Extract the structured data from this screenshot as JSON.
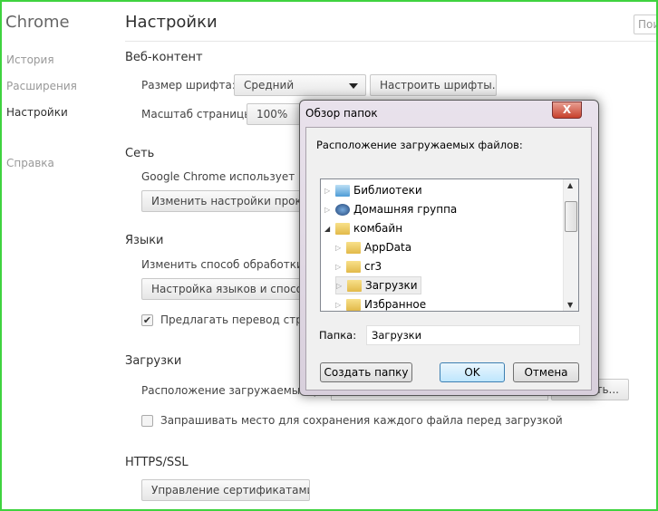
{
  "sidebar": {
    "brand": "Chrome",
    "items": [
      {
        "label": "История"
      },
      {
        "label": "Расширения"
      },
      {
        "label": "Настройки"
      },
      {
        "label": "Справка"
      }
    ]
  },
  "header": {
    "title": "Настройки",
    "search_placeholder": "Пои"
  },
  "web": {
    "title": "Веб-контент",
    "font_size_label": "Размер шрифта:",
    "font_size_value": "Средний",
    "customize_fonts": "Настроить шрифты...",
    "zoom_label": "Масштаб страницы:",
    "zoom_value": "100%"
  },
  "network": {
    "title": "Сеть",
    "text": "Google Chrome использует нас",
    "proxy_button": "Изменить настройки прокси-"
  },
  "languages": {
    "title": "Языки",
    "text": "Изменить способ обработки и",
    "button": "Настройка языков и способо",
    "translate_label": "Предлагать перевод страни",
    "translate_checked": true
  },
  "downloads": {
    "title": "Загрузки",
    "location_label": "Расположение загружаемых фа",
    "change_button": "ть...",
    "ask_label": "Запрашивать место для сохранения каждого файла перед загрузкой",
    "ask_checked": false
  },
  "https": {
    "title": "HTTPS/SSL",
    "certs_button": "Управление сертификатами..."
  },
  "dialog": {
    "title": "Обзор папок",
    "close": "X",
    "prompt": "Расположение загружаемых файлов:",
    "tree": [
      {
        "label": "Библиотеки",
        "icon": "libraries-icon"
      },
      {
        "label": "Домашняя группа",
        "icon": "homegroup-icon"
      },
      {
        "label": "комбайн",
        "icon": "user-folder-icon",
        "expanded": true
      },
      {
        "label": "AppData",
        "icon": "folder-icon"
      },
      {
        "label": "cr3",
        "icon": "folder-icon"
      },
      {
        "label": "Загрузки",
        "icon": "downloads-folder-icon",
        "selected": true
      },
      {
        "label": "Избранное",
        "icon": "favorites-folder-icon"
      }
    ],
    "folder_label": "Папка:",
    "folder_value": "Загрузки",
    "new_folder": "Создать папку",
    "ok": "OK",
    "cancel": "Отмена"
  }
}
